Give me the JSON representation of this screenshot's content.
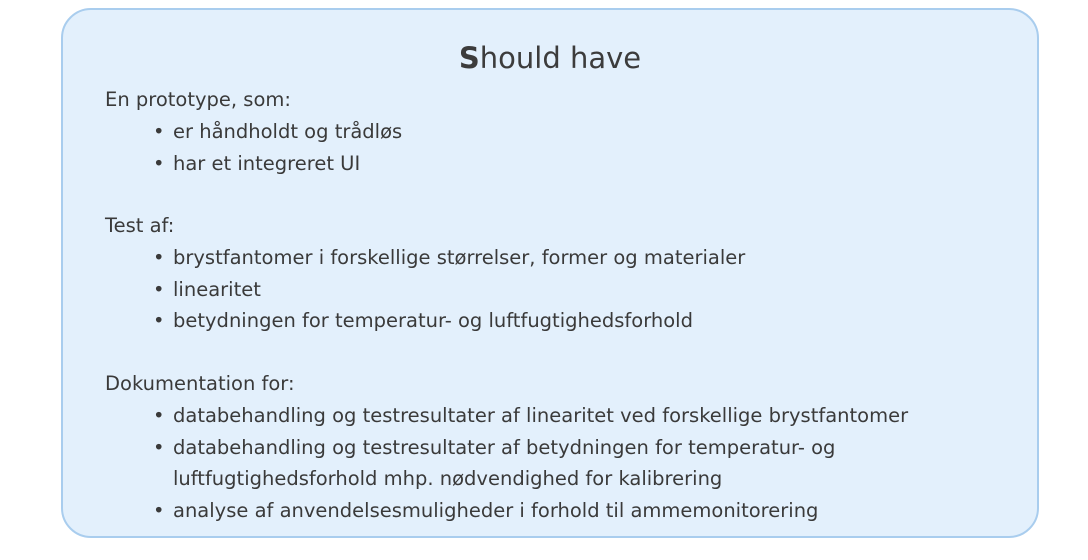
{
  "title": {
    "first_letter": "S",
    "rest": "hould have"
  },
  "sections": [
    {
      "heading": "En prototype, som:",
      "items": [
        "er håndholdt og trådløs",
        "har et integreret UI"
      ]
    },
    {
      "heading": "Test af:",
      "items": [
        "brystfantomer i forskellige størrelser, former og materialer",
        "linearitet",
        "betydningen for temperatur- og luftfugtighedsforhold"
      ]
    },
    {
      "heading": "Dokumentation for:",
      "items": [
        "databehandling og testresultater af linearitet ved forskellige brystfantomer",
        "databehandling og testresultater af betydningen for temperatur- og",
        "analyse af anvendelsesmuligheder i forhold til ammemonitorering"
      ],
      "item_2_continuation": "luftfugtighedsforhold mhp. nødvendighed for kalibrering"
    }
  ],
  "bullet_glyph": "•",
  "colors": {
    "card_background": "#e3f0fc",
    "card_border": "#a9cdee",
    "text": "#3a3a3a"
  }
}
